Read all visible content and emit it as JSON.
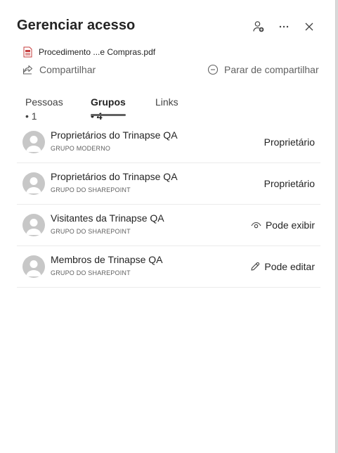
{
  "panel": {
    "title": "Gerenciar acesso"
  },
  "file": {
    "icon": "pdf-file-icon",
    "name": "Procedimento ...e Compras.pdf"
  },
  "actions": {
    "share_label": "Compartilhar",
    "stop_share_label": "Parar de compartilhar"
  },
  "tabs": [
    {
      "label": "Pessoas • 1",
      "selected": false
    },
    {
      "label": "Grupos • 4",
      "selected": true
    },
    {
      "label": "Links",
      "selected": false
    }
  ],
  "groups": [
    {
      "name": "Proprietários do Trinapse QA",
      "type": "GRUPO MODERNO",
      "role": "Proprietário",
      "role_icon": ""
    },
    {
      "name": "Proprietários do Trinapse QA",
      "type": "GRUPO DO SHAREPOINT",
      "role": "Proprietário",
      "role_icon": ""
    },
    {
      "name": "Visitantes da Trinapse QA",
      "type": "GRUPO DO SHAREPOINT",
      "role": "Pode exibir",
      "role_icon": "eye-icon"
    },
    {
      "name": "Membros de Trinapse QA",
      "type": "GRUPO DO SHAREPOINT",
      "role": "Pode editar",
      "role_icon": "pencil-icon"
    }
  ],
  "colors": {
    "text": "#242424",
    "secondary": "#616161",
    "divider": "#ebebeb",
    "avatar": "#c7c7c7",
    "pdf_red": "#c43e3e"
  }
}
